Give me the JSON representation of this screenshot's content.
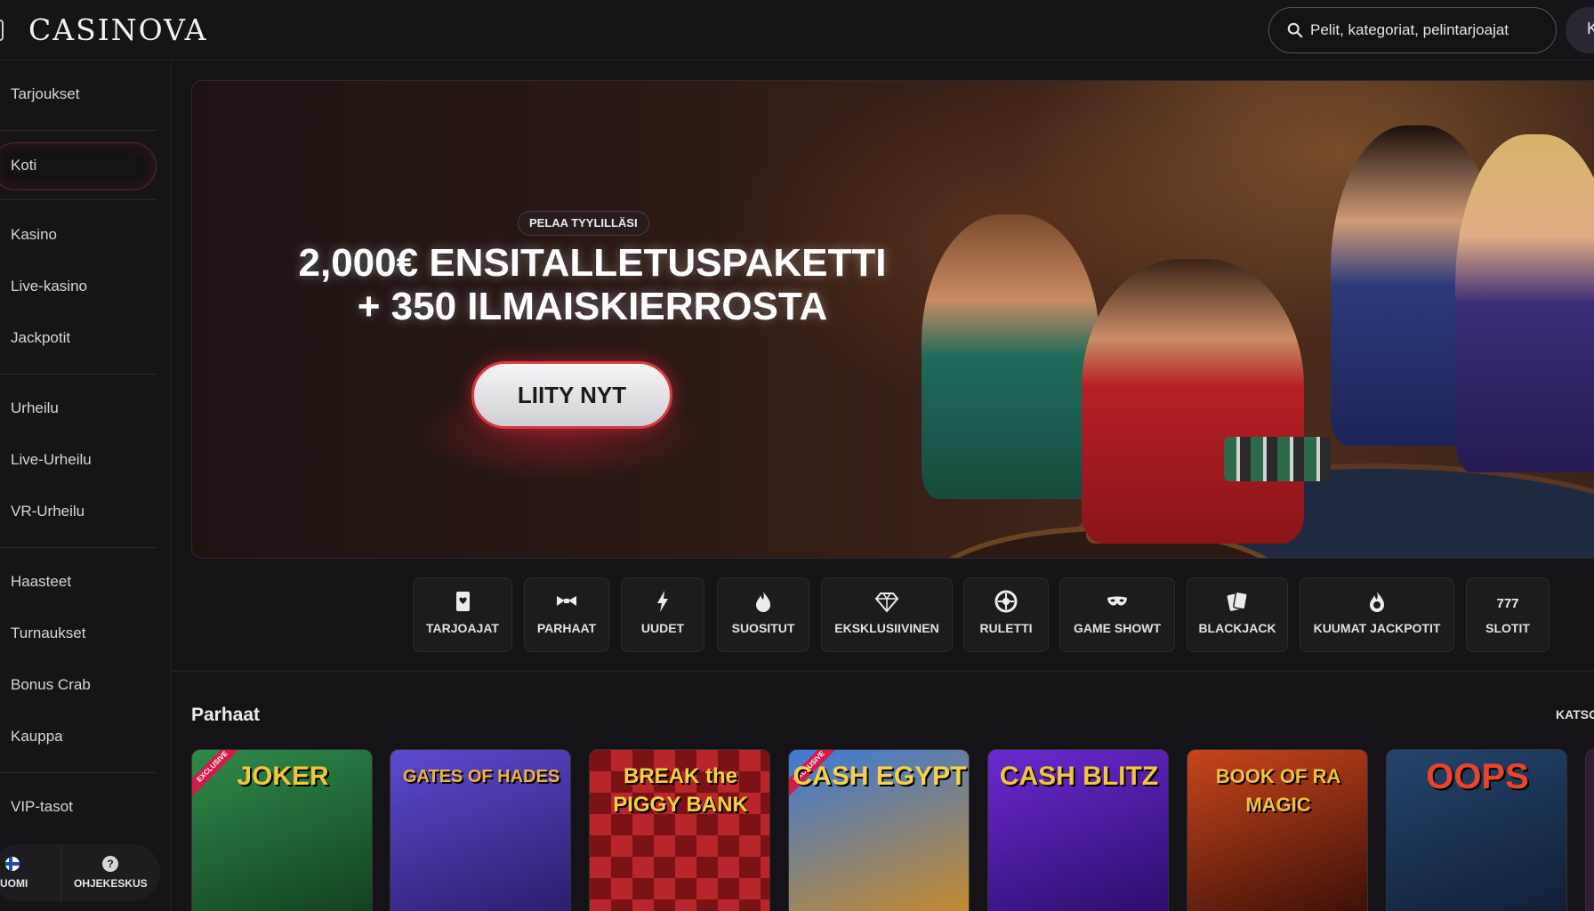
{
  "header": {
    "logo": "CASINOVA",
    "search_placeholder": "Pelit, kategoriat, pelintarjoajat",
    "login_stub": "K"
  },
  "sidebar": {
    "items": [
      {
        "label": "Tarjoukset"
      },
      {
        "label": "Koti",
        "active": true
      },
      {
        "label": "Kasino"
      },
      {
        "label": "Live-kasino"
      },
      {
        "label": "Jackpotit"
      },
      {
        "label": "Urheilu"
      },
      {
        "label": "Live-Urheilu"
      },
      {
        "label": "VR-Urheilu"
      },
      {
        "label": "Haasteet"
      },
      {
        "label": "Turnaukset"
      },
      {
        "label": "Bonus Crab"
      },
      {
        "label": "Kauppa"
      },
      {
        "label": "VIP-tasot"
      }
    ],
    "language": "UOMI",
    "help": "OHJEKESKUS"
  },
  "banner": {
    "tag": "PELAA TYYLILLÄSI",
    "line1": "2,000€ ENSITALLETUSPAKETTI",
    "line2": "+ 350 ILMAISKIERROSTA",
    "cta": "LIITY NYT"
  },
  "categories": [
    {
      "label": "TARJOAJAT",
      "icon": "provider-icon"
    },
    {
      "label": "PARHAAT",
      "icon": "bowtie-icon"
    },
    {
      "label": "UUDET",
      "icon": "lightning-icon"
    },
    {
      "label": "SUOSITUT",
      "icon": "flame-icon"
    },
    {
      "label": "EKSKLUSIIVINEN",
      "icon": "diamond-icon"
    },
    {
      "label": "RULETTI",
      "icon": "roulette-icon"
    },
    {
      "label": "GAME SHOWT",
      "icon": "mask-icon"
    },
    {
      "label": "BLACKJACK",
      "icon": "cards-icon"
    },
    {
      "label": "KUUMAT JACKPOTIT",
      "icon": "hot-jackpot-icon"
    },
    {
      "label": "SLOTIT",
      "icon": "slot-777-icon"
    }
  ],
  "games_section": {
    "title": "Parhaat",
    "see_all": "KATSO",
    "games": [
      {
        "title": "JOKER",
        "badge": "EXCLUSIVE",
        "color": "#1f6a3a"
      },
      {
        "title": "GATES OF HADES",
        "badge": "",
        "color": "#4d3aa0"
      },
      {
        "title": "BREAK the PIGGY BANK",
        "badge": "",
        "color": "#b8262b"
      },
      {
        "title": "CASH EGYPT",
        "badge": "EXCLUSIVE",
        "color": "#2d5bb0"
      },
      {
        "title": "CASH BLITZ",
        "badge": "",
        "color": "#4a1f9a"
      },
      {
        "title": "BOOK OF RA MAGIC",
        "badge": "",
        "color": "#8a2a14"
      },
      {
        "title": "OOPS",
        "badge": "",
        "color": "#1d3a5a"
      }
    ]
  },
  "colors": {
    "background": "#151318",
    "accent_red": "#d8383f",
    "cta_fill": "#e8e8ee"
  }
}
